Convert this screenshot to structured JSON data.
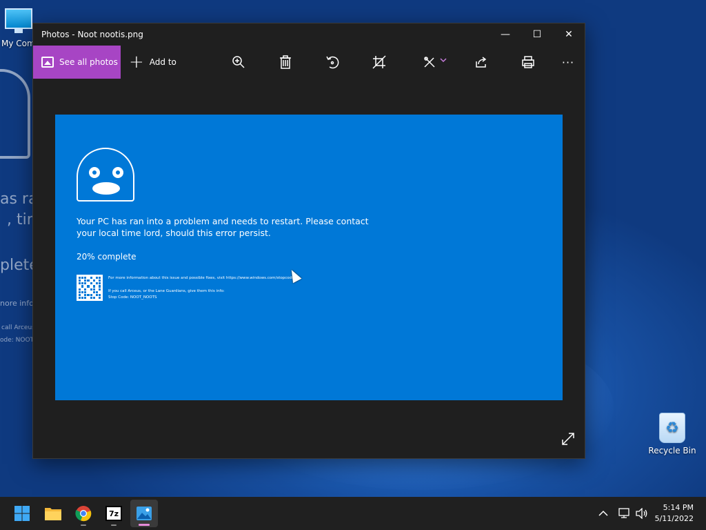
{
  "desktop": {
    "my_computer_label": "My Com",
    "recycle_bin_label": "Recycle Bin",
    "ghost_line1": "as ra",
    "ghost_line2": ", tim",
    "ghost_line3": "plete",
    "ghost_line4": "nore info",
    "ghost_line5": "call Arceus",
    "ghost_line6": "ode: NOOT"
  },
  "window": {
    "title": "Photos - Noot nootis.png",
    "see_all_label": "See all photos",
    "add_to_label": "Add to",
    "minimize": "—",
    "maximize": "☐",
    "close": "✕",
    "more": "···"
  },
  "bsod": {
    "message_line1": "Your PC has ran into a problem and needs to restart. Please contact",
    "message_line2": "your local time lord, should this error persist.",
    "progress": "20% complete",
    "info_line": "For more information about this issue and possible fixes, visit https://www.windows.com/stopcodular",
    "call_line": "If you call Arceus, or the Lane Guardians, give them this info:",
    "stop_code": "Stop Code: NOOT_NOOTS"
  },
  "taskbar": {
    "time": "5:14 PM",
    "date": "5/11/2022",
    "tray_chevron": "^"
  },
  "colors": {
    "accent": "#a745c4",
    "bsod_blue": "#0078d7",
    "window_bg": "#1f1f1f",
    "taskbar_bg": "#202020"
  }
}
